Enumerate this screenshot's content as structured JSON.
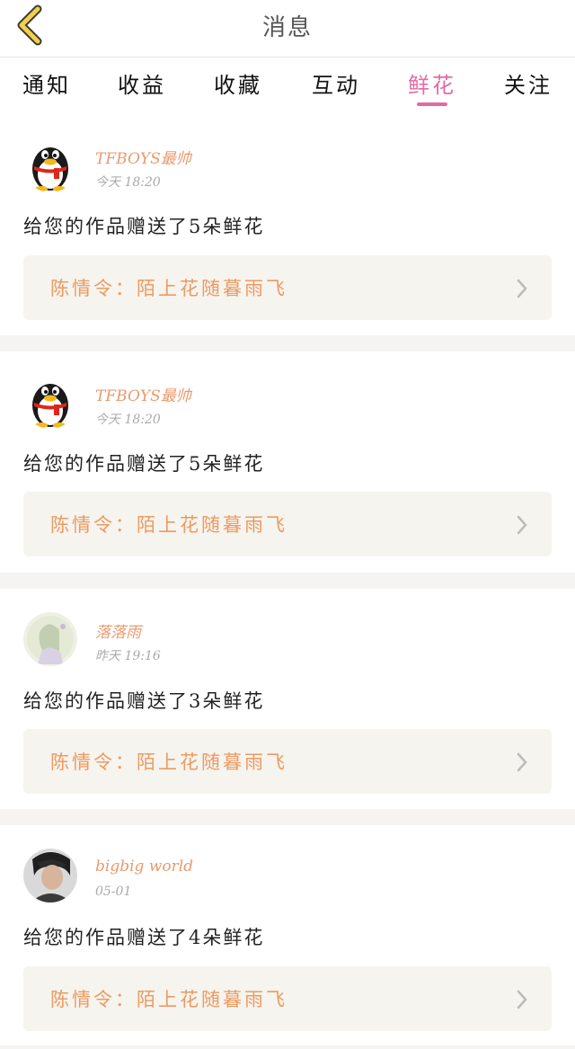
{
  "header": {
    "title": "消息",
    "back_icon": "chevron-left-icon",
    "back_color": "#e8c84a"
  },
  "tabs": [
    {
      "label": "通知",
      "active": false
    },
    {
      "label": "收益",
      "active": false
    },
    {
      "label": "收藏",
      "active": false
    },
    {
      "label": "互动",
      "active": false
    },
    {
      "label": "鲜花",
      "active": true
    },
    {
      "label": "关注",
      "active": false
    }
  ],
  "accent_color": "#e46aa3",
  "messages": [
    {
      "username": "TFBOYS最帅",
      "time": "今天  18:20",
      "content": "给您的作品赠送了5朵鲜花",
      "reference": "陈情令：陌上花随暮雨飞",
      "avatar": "penguin-avatar"
    },
    {
      "username": "TFBOYS最帅",
      "time": "今天  18:20",
      "content": "给您的作品赠送了5朵鲜花",
      "reference": "陈情令：陌上花随暮雨飞",
      "avatar": "penguin-avatar"
    },
    {
      "username": "落落雨",
      "time": "昨天  19:16",
      "content": "给您的作品赠送了3朵鲜花",
      "reference": "陈情令：陌上花随暮雨飞",
      "avatar": "illustration-avatar"
    },
    {
      "username": "bigbig world",
      "time": "05-01",
      "content": "给您的作品赠送了4朵鲜花",
      "reference": "陈情令：陌上花随暮雨飞",
      "avatar": "photo-avatar"
    }
  ]
}
